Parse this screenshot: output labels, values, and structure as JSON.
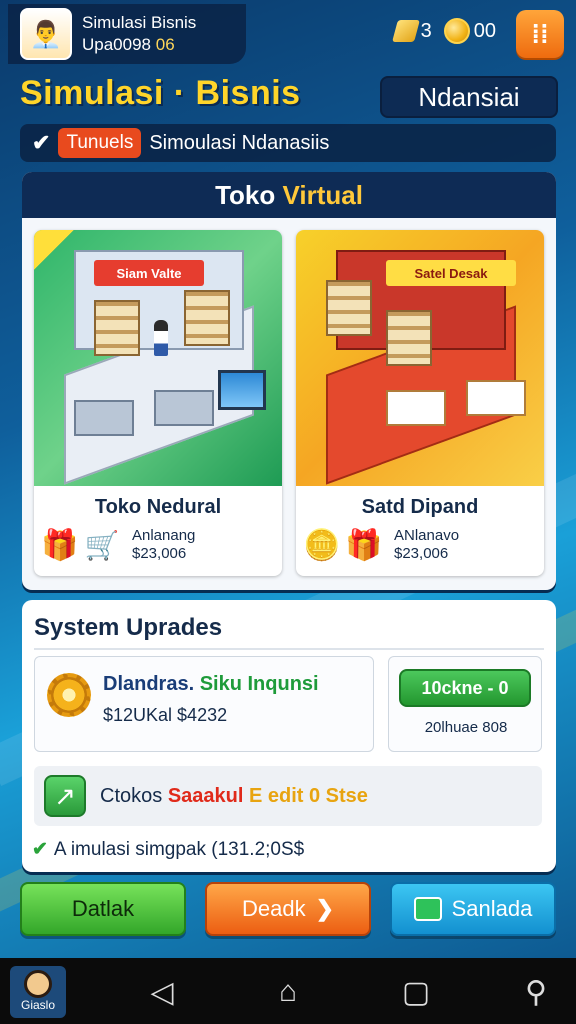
{
  "profile": {
    "name": "Simulasi Bisnis",
    "subline_a": "Upa0098",
    "subline_b": "06"
  },
  "currency": {
    "gems": "3",
    "coins": "00",
    "gem_icon": "gem-icon",
    "coin_icon": "coin-icon"
  },
  "header": {
    "title": "Simulasi · Bisnis",
    "region": "Ndansiai",
    "menu_icon": "menu-icon"
  },
  "tutorial": {
    "badge": "Tunuels",
    "text": "Simoulasi Ndanasiis"
  },
  "shop": {
    "title_main": "Toko ",
    "title_accent": "Virtual",
    "stores": [
      {
        "name": "Toko Nedural",
        "meta_label": "Anlanang",
        "meta_value": "$23,006",
        "sign": "Siam Valte",
        "icons": [
          "gift-box-icon",
          "shopping-cart-icon"
        ]
      },
      {
        "name": "Satd Dipand",
        "meta_label": "ANlanavo",
        "meta_value": "$23,006",
        "sign": "Satel Desak",
        "icons": [
          "coin-stack-icon",
          "gift-box-icon"
        ]
      }
    ]
  },
  "upgrades": {
    "title": "System Uprades",
    "item": {
      "name": "Dlandras. ",
      "name_accent": "Siku Inqunsi",
      "cost": "$12UKal $4232"
    },
    "unlock_label": "10ckne - 0",
    "unlock_note": "20lhuae 808",
    "promo": {
      "prefix": "Ctokos ",
      "hot": "Saaakul ",
      "gold": "E edit 0 Stse"
    },
    "status": "A imulasi simgpak (131.2;0S$"
  },
  "actions": {
    "left": "Datlak",
    "middle": "Deadk",
    "right": "Sanlada"
  },
  "navbar": {
    "avatar_label": "Giaslo",
    "back_icon": "back-icon",
    "home_icon": "home-icon",
    "recent_icon": "recent-apps-icon",
    "tools_icon": "tools-icon"
  }
}
